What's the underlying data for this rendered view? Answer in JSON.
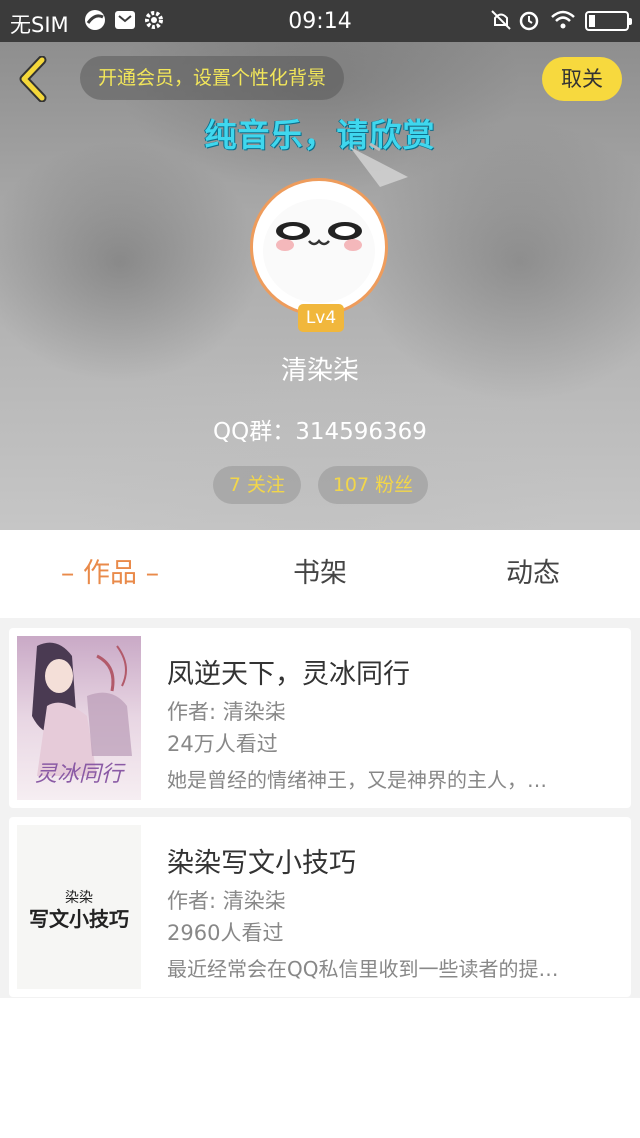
{
  "status_bar": {
    "carrier": "无SIM",
    "time": "09:14"
  },
  "header": {
    "vip_prompt": "开通会员，设置个性化背景",
    "unfollow_label": "取关",
    "banner_text": "纯音乐，请欣赏",
    "level": "Lv4",
    "nickname": "清染柒",
    "qq_group": "QQ群：314596369",
    "following": "7 关注",
    "fans": "107 粉丝"
  },
  "tabs": {
    "works": "– 作品 –",
    "shelf": "书架",
    "activity": "动态"
  },
  "books": [
    {
      "title": "凤逆天下，灵冰同行",
      "author": "作者: 清染柒",
      "views": "24万人看过",
      "desc": "她是曾经的情绪神王，又是神界的主人，…",
      "cover_text": "灵冰同行"
    },
    {
      "title": "染染写文小技巧",
      "author": "作者: 清染柒",
      "views": "2960人看过",
      "desc": "最近经常会在QQ私信里收到一些读者的提…",
      "cover_text_top": "染染",
      "cover_text": "写文小技巧"
    }
  ],
  "colors": {
    "accent_orange": "#e98a4a",
    "button_yellow": "#f7d93e",
    "banner_cyan": "#3fd7ee"
  }
}
